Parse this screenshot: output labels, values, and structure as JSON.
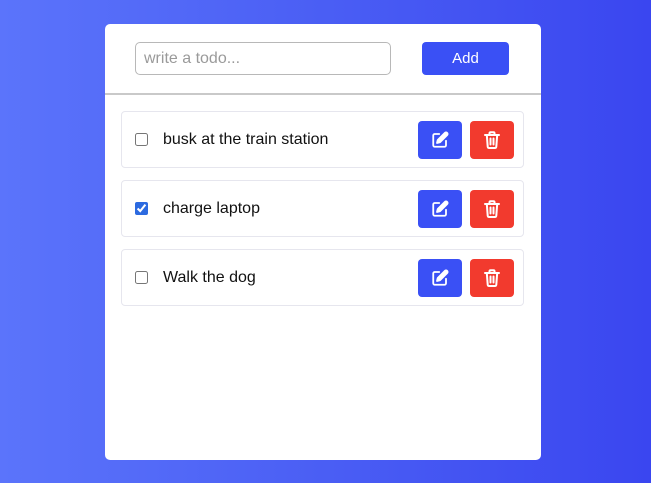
{
  "new_todo": {
    "value": "",
    "placeholder": "write a todo...",
    "add_label": "Add"
  },
  "todos": [
    {
      "text": "busk at the train station",
      "completed": false
    },
    {
      "text": "charge laptop",
      "completed": true
    },
    {
      "text": "Walk the dog",
      "completed": false
    }
  ],
  "icons": {
    "edit": "edit-icon",
    "delete": "trash-icon"
  },
  "colors": {
    "accent": "#3a50f5",
    "danger": "#f23a2e",
    "background_start": "#5b74fb",
    "background_end": "#3a46f0"
  }
}
